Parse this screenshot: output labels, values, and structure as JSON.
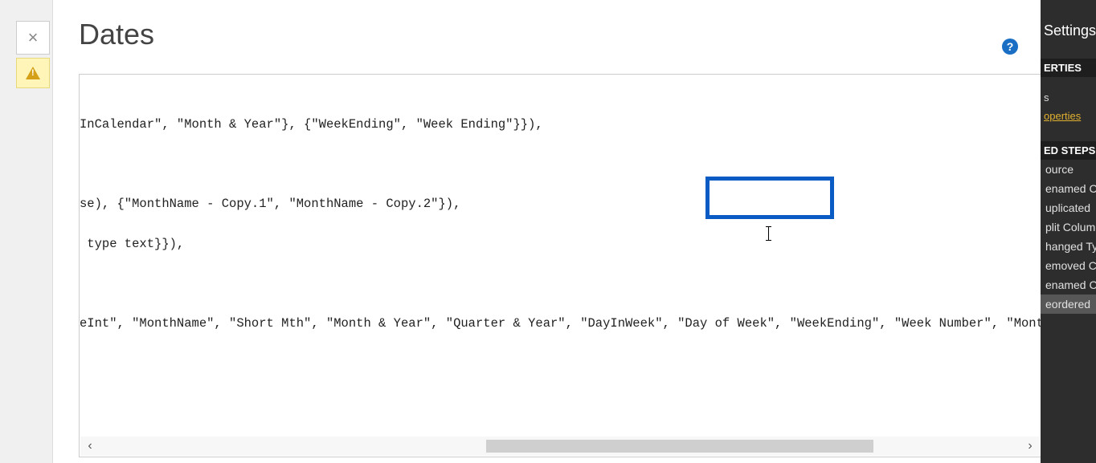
{
  "dialog": {
    "title": "Dates",
    "help_tooltip": "?"
  },
  "code": {
    "line1": "InCalendar\", \"Month & Year\"}, {\"WeekEnding\", \"Week Ending\"}}),",
    "line2": "se), {\"MonthName - Copy.1\", \"MonthName - Copy.2\"}),",
    "line3": " type text}}),",
    "line4": "eInt\", \"MonthName\", \"Short Mth\", \"Month & Year\", \"Quarter & Year\", \"DayInWeek\", \"Day of Week\", \"WeekEnding\", \"Week Number\", \"MonthnYear\", \"Quar"
  },
  "highlight": {
    "target_text": "\"WeekEnding\""
  },
  "scrollbar": {
    "left_arrow": "‹",
    "right_arrow": "›"
  },
  "right_panel": {
    "title": "Settings",
    "section_properties": "ERTIES",
    "name_row": "s",
    "properties_link": "operties",
    "section_steps": "ED STEPS",
    "steps": [
      "ource",
      "enamed C",
      "uplicated",
      "plit Colum",
      "hanged Ty",
      "emoved C",
      "enamed C",
      "eordered "
    ],
    "selected_step_index": 7
  },
  "close_button": "×"
}
